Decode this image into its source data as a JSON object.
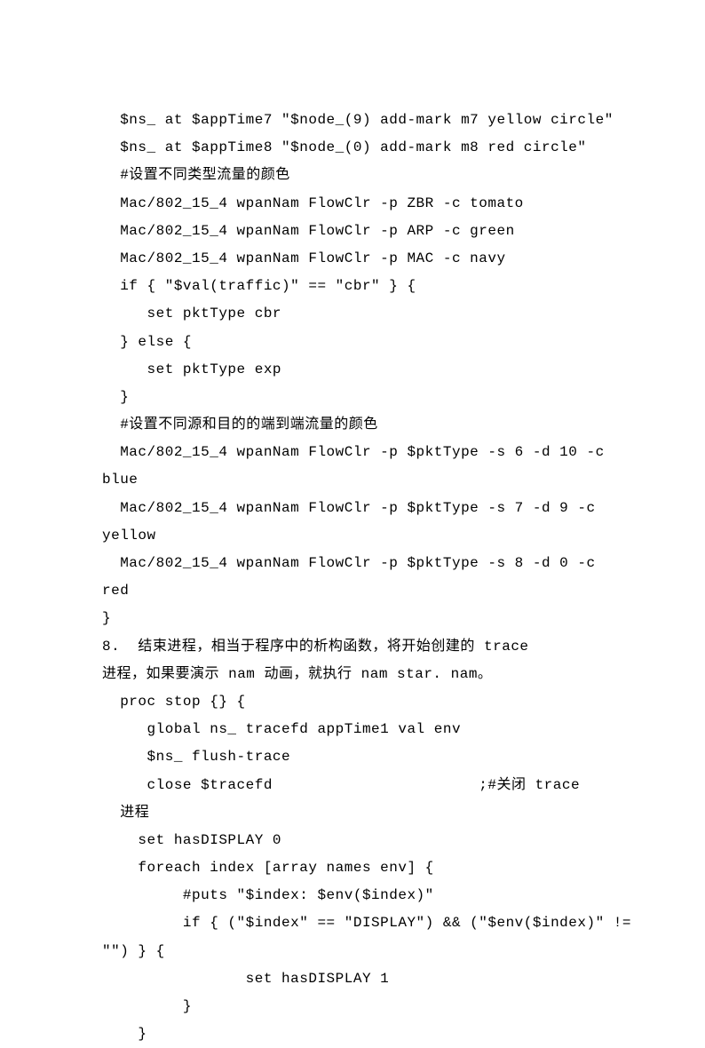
{
  "lines": [
    "  $ns_ at $appTime7 \"$node_(9) add-mark m7 yellow circle\"",
    "  $ns_ at $appTime8 \"$node_(0) add-mark m8 red circle\"",
    "  #设置不同类型流量的颜色",
    "  Mac/802_15_4 wpanNam FlowClr -p ZBR -c tomato",
    "  Mac/802_15_4 wpanNam FlowClr -p ARP -c green",
    "  Mac/802_15_4 wpanNam FlowClr -p MAC -c navy",
    "  if { \"$val(traffic)\" == \"cbr\" } {",
    "     set pktType cbr",
    "  } else {",
    "     set pktType exp",
    "  }",
    "  #设置不同源和目的的端到端流量的颜色",
    "  Mac/802_15_4 wpanNam FlowClr -p $pktType -s 6 -d 10 -c ",
    "blue",
    "  Mac/802_15_4 wpanNam FlowClr -p $pktType -s 7 -d 9 -c ",
    "yellow",
    "  Mac/802_15_4 wpanNam FlowClr -p $pktType -s 8 -d 0 -c ",
    "red",
    "}",
    "8.  结束进程，相当于程序中的析构函数，将开始创建的 trace",
    "进程，如果要演示 nam 动画，就执行 nam star. nam。",
    "  proc stop {} {",
    "     global ns_ tracefd appTime1 val env",
    "     $ns_ flush-trace",
    "     close $tracefd                       ;#关闭 trace",
    "  进程",
    "    set hasDISPLAY 0",
    "    foreach index [array names env] {",
    "         #puts \"$index: $env($index)\"",
    "         if { (\"$index\" == \"DISPLAY\") && (\"$env($index)\" != ",
    "\"\") } {",
    "                set hasDISPLAY 1",
    "         }",
    "    }"
  ]
}
